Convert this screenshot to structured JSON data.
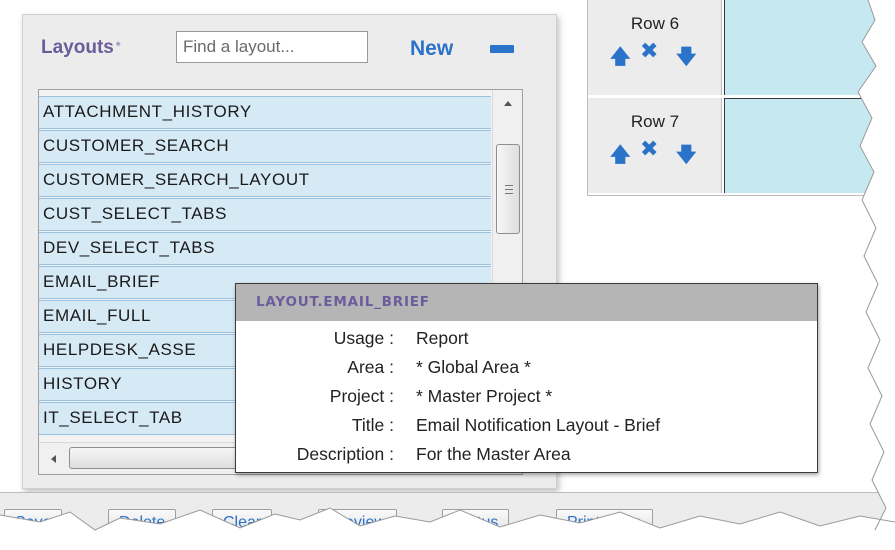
{
  "layouts": {
    "label": "Layouts",
    "required_marker": "*",
    "search_placeholder": "Find a layout...",
    "new_label": "New",
    "items": [
      "ATTACHMENT_HISTORY",
      "CUSTOMER_SEARCH",
      "CUSTOMER_SEARCH_LAYOUT",
      "CUST_SELECT_TABS",
      "DEV_SELECT_TABS",
      "EMAIL_BRIEF",
      "EMAIL_FULL",
      "HELPDESK_ASSE",
      "HISTORY",
      "IT_SELECT_TAB"
    ]
  },
  "rows": [
    {
      "label": "Row 6"
    },
    {
      "label": "Row 7"
    }
  ],
  "icons": {
    "up": "🡅",
    "delete": "✖",
    "down": "🡇"
  },
  "tooltip": {
    "title": "LAYOUT.EMAIL_BRIEF",
    "fields": [
      {
        "key": "Usage :",
        "value": "Report"
      },
      {
        "key": "Area :",
        "value": "* Global Area *"
      },
      {
        "key": "Project :",
        "value": "* Master Project *"
      },
      {
        "key": "Title :",
        "value": "Email Notification Layout - Brief"
      },
      {
        "key": "Description :",
        "value": "For the Master Area"
      }
    ]
  },
  "toolbar": {
    "buttons": [
      "Save",
      "Delete",
      "Clear",
      "Preview",
      "Status",
      "Print Page"
    ]
  },
  "colors": {
    "accent_blue": "#2b72c9",
    "label_purple": "#6b5d9c",
    "list_row_bg": "#d6eaf6",
    "row_content_bg": "#c6e9f1",
    "panel_bg": "#ececec"
  }
}
